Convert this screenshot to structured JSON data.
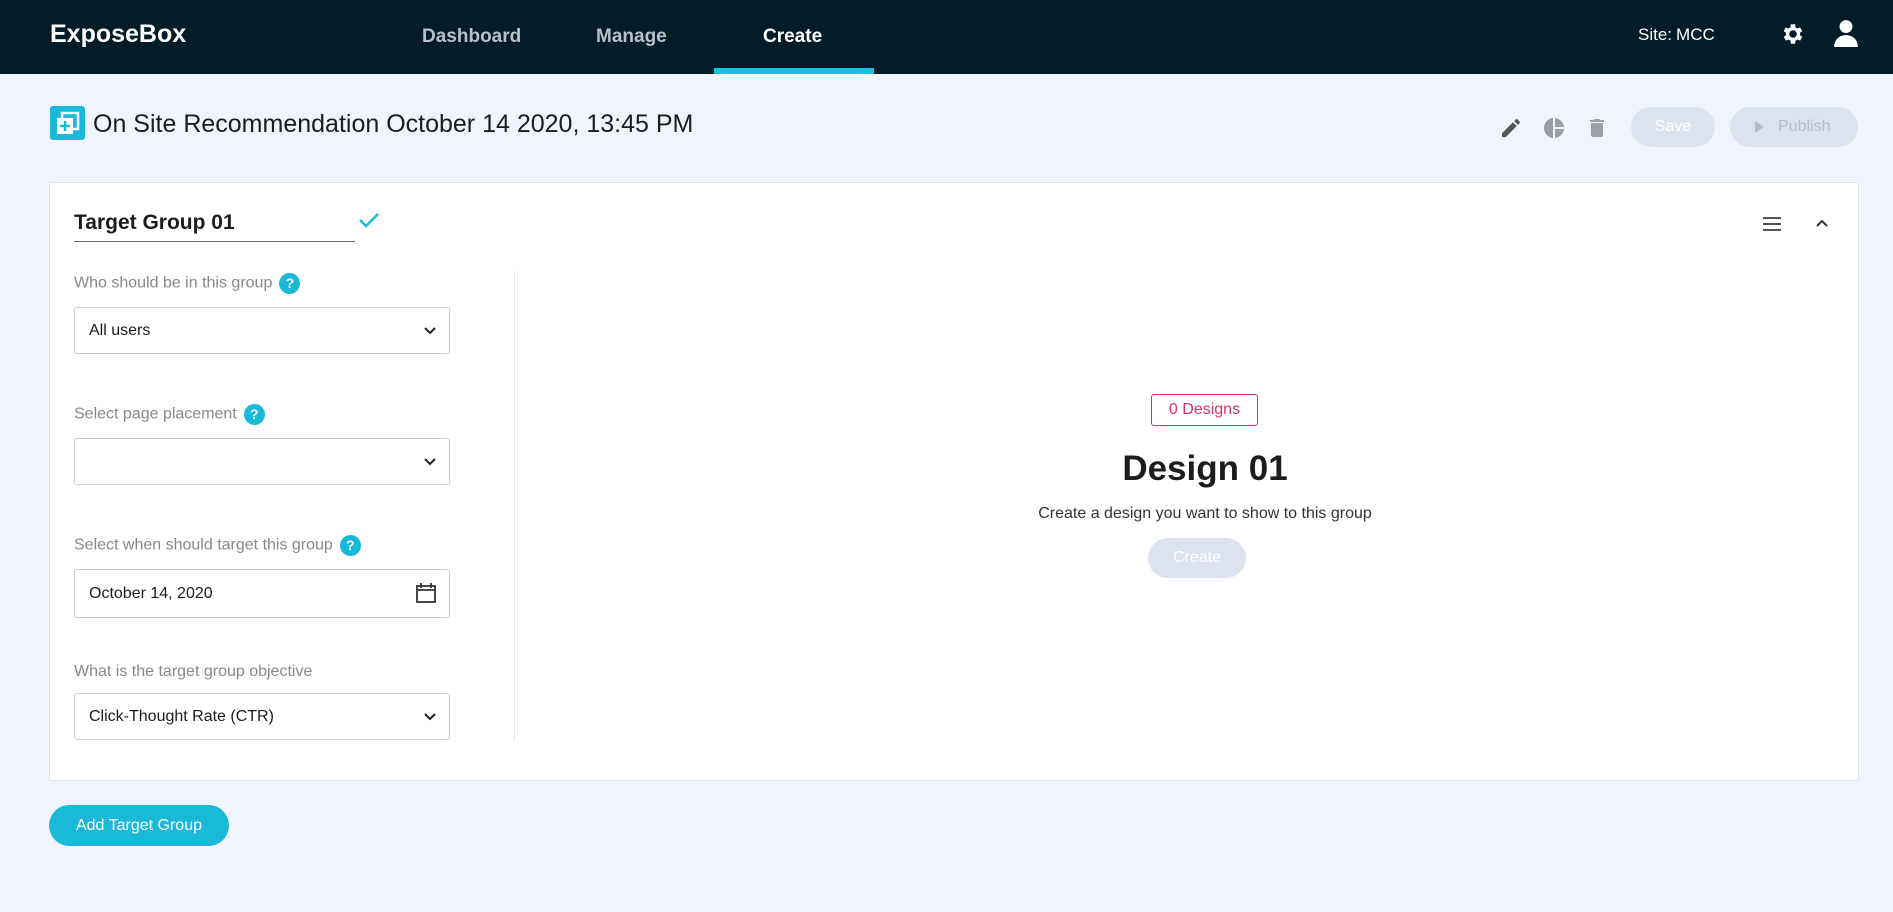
{
  "app": {
    "brand": "ExposeBox"
  },
  "nav": {
    "items": [
      {
        "label": "Dashboard"
      },
      {
        "label": "Manage"
      },
      {
        "label": "Create"
      }
    ],
    "site_label": "Site:",
    "site_value": "MCC"
  },
  "header": {
    "title": "On Site Recommendation October 14 2020, 13:45 PM",
    "save_label": "Save",
    "publish_label": "Publish"
  },
  "target_group": {
    "name": "Target Group 01",
    "who_label": "Who should be in this group",
    "who_value": "All users",
    "placement_label": "Select page placement",
    "placement_value": "",
    "when_label": "Select when should target this group",
    "when_value": "October 14, 2020",
    "objective_label": "What is the target group objective",
    "objective_value": "Click-Thought Rate (CTR)",
    "help_glyph": "?"
  },
  "design": {
    "badge": "0 Designs",
    "title": "Design 01",
    "subtitle": "Create a design you want to show to this group",
    "create_label": "Create"
  },
  "footer": {
    "add_label": "Add Target Group"
  },
  "colors": {
    "nav_bg": "#021c28",
    "accent": "#19c0e0",
    "badge": "#d4336a",
    "disabled_btn": "#dde3ee"
  },
  "icons": [
    "gear-icon",
    "user-icon",
    "add-page-icon",
    "pencil-icon",
    "pie-chart-icon",
    "trash-icon",
    "play-icon",
    "check-icon",
    "menu-icon",
    "chevron-up-icon",
    "chevron-down-icon",
    "calendar-icon",
    "help-icon"
  ]
}
